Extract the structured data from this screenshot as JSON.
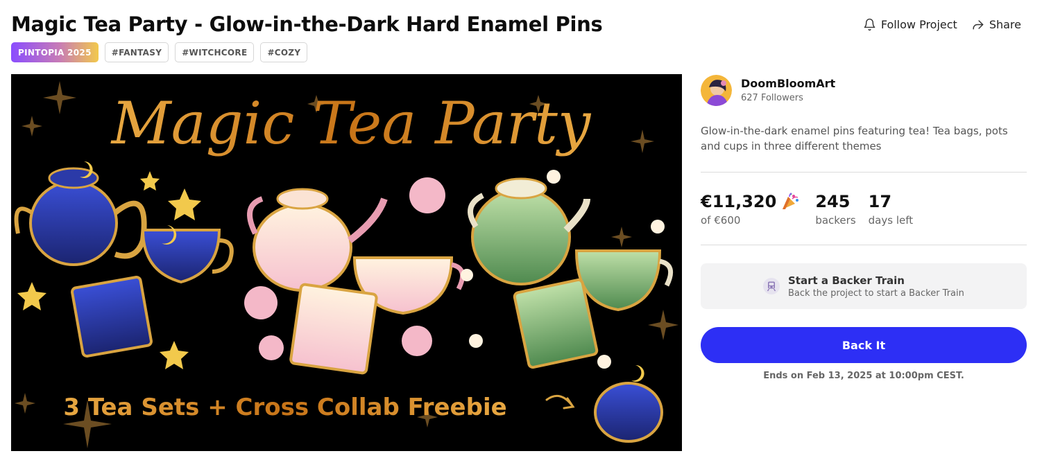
{
  "project": {
    "title": "Magic Tea Party - Glow-in-the-Dark Hard Enamel Pins",
    "description": "Glow-in-the-dark enamel pins featuring tea! Tea bags, pots and cups in three different themes"
  },
  "actions": {
    "follow_label": "Follow Project",
    "share_label": "Share"
  },
  "tags": [
    "PINTOPIA 2025",
    "#FANTASY",
    "#WITCHCORE",
    "#COZY"
  ],
  "hero": {
    "title_text": "Magic Tea Party",
    "banner_text": "3 Tea Sets + Cross Collab Freebie"
  },
  "creator": {
    "name": "DoomBloomArt",
    "followers": "627 Followers"
  },
  "stats": {
    "raised": "€11,320",
    "goal": "of €600",
    "backers": "245",
    "backers_label": "backers",
    "days": "17",
    "days_label": "days left"
  },
  "backer_train": {
    "title": "Start a Backer Train",
    "subtitle": "Back the project to start a Backer Train"
  },
  "cta": {
    "back_label": "Back It",
    "ends_text": "Ends on Feb 13, 2025 at 10:00pm CEST."
  },
  "colors": {
    "primary_button": "#2d2ff5",
    "hero_gold": "#d4912a",
    "hero_background": "#000000"
  }
}
